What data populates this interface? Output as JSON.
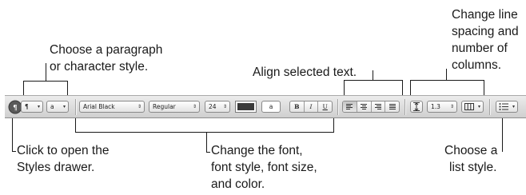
{
  "callouts": {
    "style": [
      "Choose a paragraph",
      "or character style."
    ],
    "align": [
      "Align selected text."
    ],
    "spacing": [
      "Change line",
      "spacing and",
      "number of",
      "columns."
    ],
    "drawer": [
      "Click to open the",
      "Styles drawer."
    ],
    "font": [
      "Change the font,",
      "font style, font size,",
      "and color."
    ],
    "list": [
      "Choose a",
      "list style."
    ]
  },
  "toolbar": {
    "paragraph_style_glyph": "¶",
    "character_style_glyph": "a",
    "font_family": "Arial Black",
    "font_style": "Regular",
    "font_size": "24",
    "text_color": "#3a3a3a",
    "highlight_glyph": "a",
    "bold": "B",
    "italic": "I",
    "underline": "U",
    "line_spacing": "1.3",
    "dropdown_arrow": "▾",
    "stepper_arrows": "⇕"
  },
  "icons": {
    "styles_drawer": "styles-drawer-icon",
    "align_left": "align-left-icon",
    "align_center": "align-center-icon",
    "align_right": "align-right-icon",
    "align_justify": "align-justify-icon",
    "line_spacing": "line-spacing-icon",
    "columns": "columns-icon",
    "list": "list-style-icon"
  }
}
